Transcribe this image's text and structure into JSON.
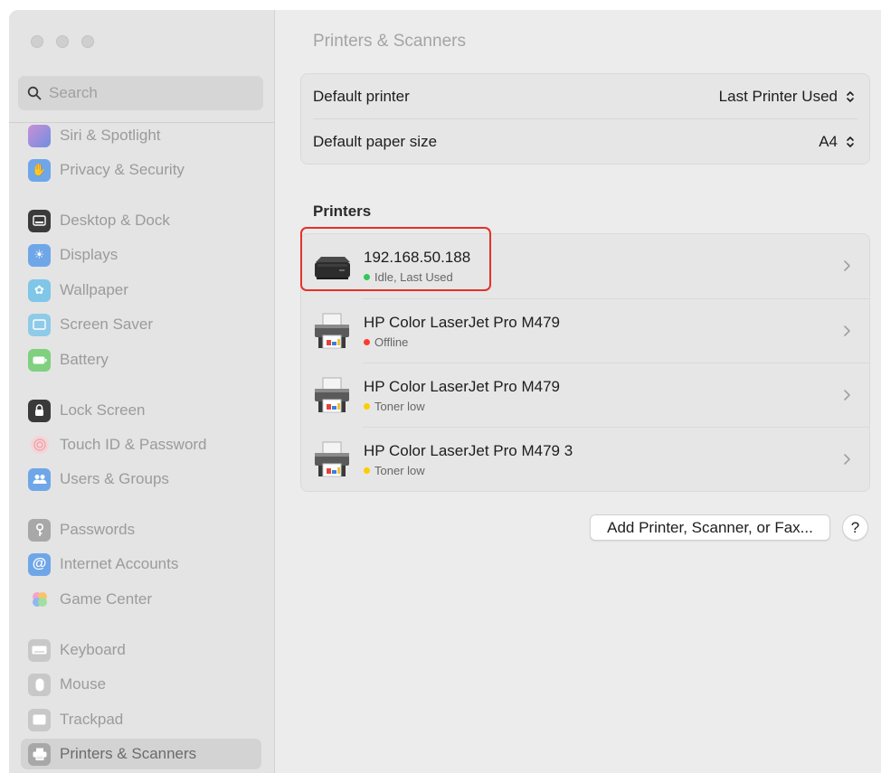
{
  "window": {
    "traffic_lights": [
      "close",
      "minimize",
      "zoom"
    ]
  },
  "sidebar": {
    "search_placeholder": "Search",
    "items": [
      {
        "label": "Siri & Spotlight",
        "icon": "siri-icon",
        "color": "#9a7fb8"
      },
      {
        "label": "Privacy & Security",
        "icon": "hand-icon",
        "color": "#6fa6e8"
      },
      {
        "label": "Desktop & Dock",
        "icon": "dock-icon",
        "color": "#3a3a3a"
      },
      {
        "label": "Displays",
        "icon": "sun-icon",
        "color": "#6fa6e8"
      },
      {
        "label": "Wallpaper",
        "icon": "flower-icon",
        "color": "#7fc6e8"
      },
      {
        "label": "Screen Saver",
        "icon": "screen-saver-icon",
        "color": "#8fcbe8"
      },
      {
        "label": "Battery",
        "icon": "battery-icon",
        "color": "#7fd07f"
      },
      {
        "label": "Lock Screen",
        "icon": "lock-icon",
        "color": "#3a3a3a"
      },
      {
        "label": "Touch ID & Password",
        "icon": "fingerprint-icon",
        "color": "#f0a0a8"
      },
      {
        "label": "Users & Groups",
        "icon": "users-icon",
        "color": "#6fa6e8"
      },
      {
        "label": "Passwords",
        "icon": "key-icon",
        "color": "#a8a8a8"
      },
      {
        "label": "Internet Accounts",
        "icon": "at-icon",
        "color": "#6fa6e8"
      },
      {
        "label": "Game Center",
        "icon": "game-center-icon",
        "color": "#f0a060"
      },
      {
        "label": "Keyboard",
        "icon": "keyboard-icon",
        "color": "#b8b8b8"
      },
      {
        "label": "Mouse",
        "icon": "mouse-icon",
        "color": "#b8b8b8"
      },
      {
        "label": "Trackpad",
        "icon": "trackpad-icon",
        "color": "#b8b8b8"
      },
      {
        "label": "Printers & Scanners",
        "icon": "printer-icon",
        "color": "#a8a8a8"
      }
    ]
  },
  "main": {
    "title": "Printers & Scanners",
    "settings": {
      "default_printer_label": "Default printer",
      "default_printer_value": "Last Printer Used",
      "paper_size_label": "Default paper size",
      "paper_size_value": "A4"
    },
    "printers_heading": "Printers",
    "printers": [
      {
        "name": "192.168.50.188",
        "status": "Idle, Last Used",
        "status_color": "#34c759"
      },
      {
        "name": "HP Color LaserJet Pro M479",
        "status": "Offline",
        "status_color": "#ff3b30"
      },
      {
        "name": "HP Color LaserJet Pro M479",
        "status": "Toner low",
        "status_color": "#ffcc00"
      },
      {
        "name": "HP Color LaserJet Pro M479 3",
        "status": "Toner low",
        "status_color": "#ffcc00"
      }
    ],
    "add_button": "Add Printer, Scanner, or Fax...",
    "help_button": "?"
  },
  "colors": {
    "highlight": "#e53127"
  }
}
